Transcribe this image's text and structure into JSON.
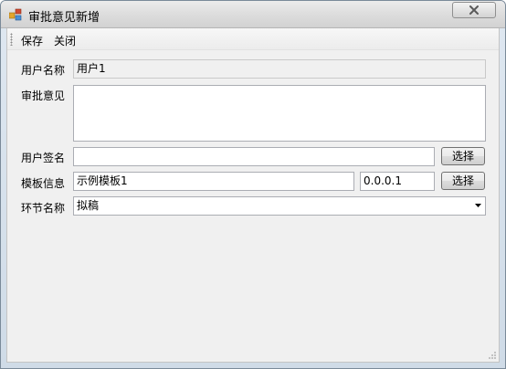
{
  "window": {
    "title": "审批意见新增",
    "close_glyph": "close-icon"
  },
  "toolbar": {
    "save_label": "保存",
    "close_label": "关闭"
  },
  "form": {
    "user_name_label": "用户名称",
    "user_name_value": "用户1",
    "approval_opinion_label": "审批意见",
    "approval_opinion_value": "",
    "user_signature_label": "用户签名",
    "user_signature_value": "",
    "signature_select_label": "选择",
    "template_label": "模板信息",
    "template_name_value": "示例模板1",
    "template_version_value": "0.0.0.1",
    "template_select_label": "选择",
    "node_label": "环节名称",
    "node_value": "拟稿"
  },
  "colors": {
    "client_bg": "#f0f0f0",
    "field_border": "#abadb3",
    "title_bar": "#dedede"
  }
}
